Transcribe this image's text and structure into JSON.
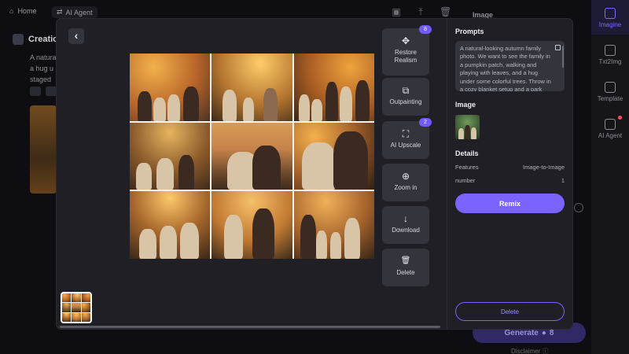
{
  "topbar": {
    "home_label": "Home",
    "agent_label": "AI Agent"
  },
  "background": {
    "image_panel_label": "Image",
    "left_title": "Creatio",
    "left_text": "A natura a hug u staged"
  },
  "rail": {
    "items": [
      {
        "label": "Imagine",
        "icon": "image-icon"
      },
      {
        "label": "Txt2Img",
        "icon": "text-to-image-icon"
      },
      {
        "label": "Template",
        "icon": "template-icon"
      },
      {
        "label": "AI Agent",
        "icon": "agent-icon"
      }
    ]
  },
  "bg_generate": {
    "label": "Generate",
    "credits": "8",
    "disclaimer": "Disclaimer"
  },
  "viewer": {
    "back_icon": "chevron-left-icon",
    "tools": [
      {
        "label": "Restore Realism",
        "glyph": "✥",
        "badge": "8"
      },
      {
        "label": "Outpainting",
        "glyph": "⧉",
        "badge": ""
      },
      {
        "label": "AI Upscale",
        "glyph": "⛶",
        "badge": "2"
      },
      {
        "label": "Zoom in",
        "glyph": "⊕",
        "badge": ""
      },
      {
        "label": "Download",
        "glyph": "↓",
        "badge": ""
      },
      {
        "label": "Delete",
        "glyph": "🗑",
        "badge": ""
      }
    ]
  },
  "side": {
    "prompts_heading": "Prompts",
    "prompt_text": "A natural-looking autumn family photo. We want to see the family in a pumpkin patch, walking and playing with leaves, and a hug under some colorful trees. Throw in a cozy blanket setup and a park",
    "image_heading": "Image",
    "details_heading": "Details",
    "details": [
      {
        "key": "Features",
        "value": "Image-to-Image"
      },
      {
        "key": "number",
        "value": "1"
      }
    ],
    "remix_label": "Remix",
    "delete_label": "Delete"
  },
  "colors": {
    "accent": "#7a63ff",
    "modal_bg": "#1f1f25",
    "tool_bg": "#34343c"
  }
}
